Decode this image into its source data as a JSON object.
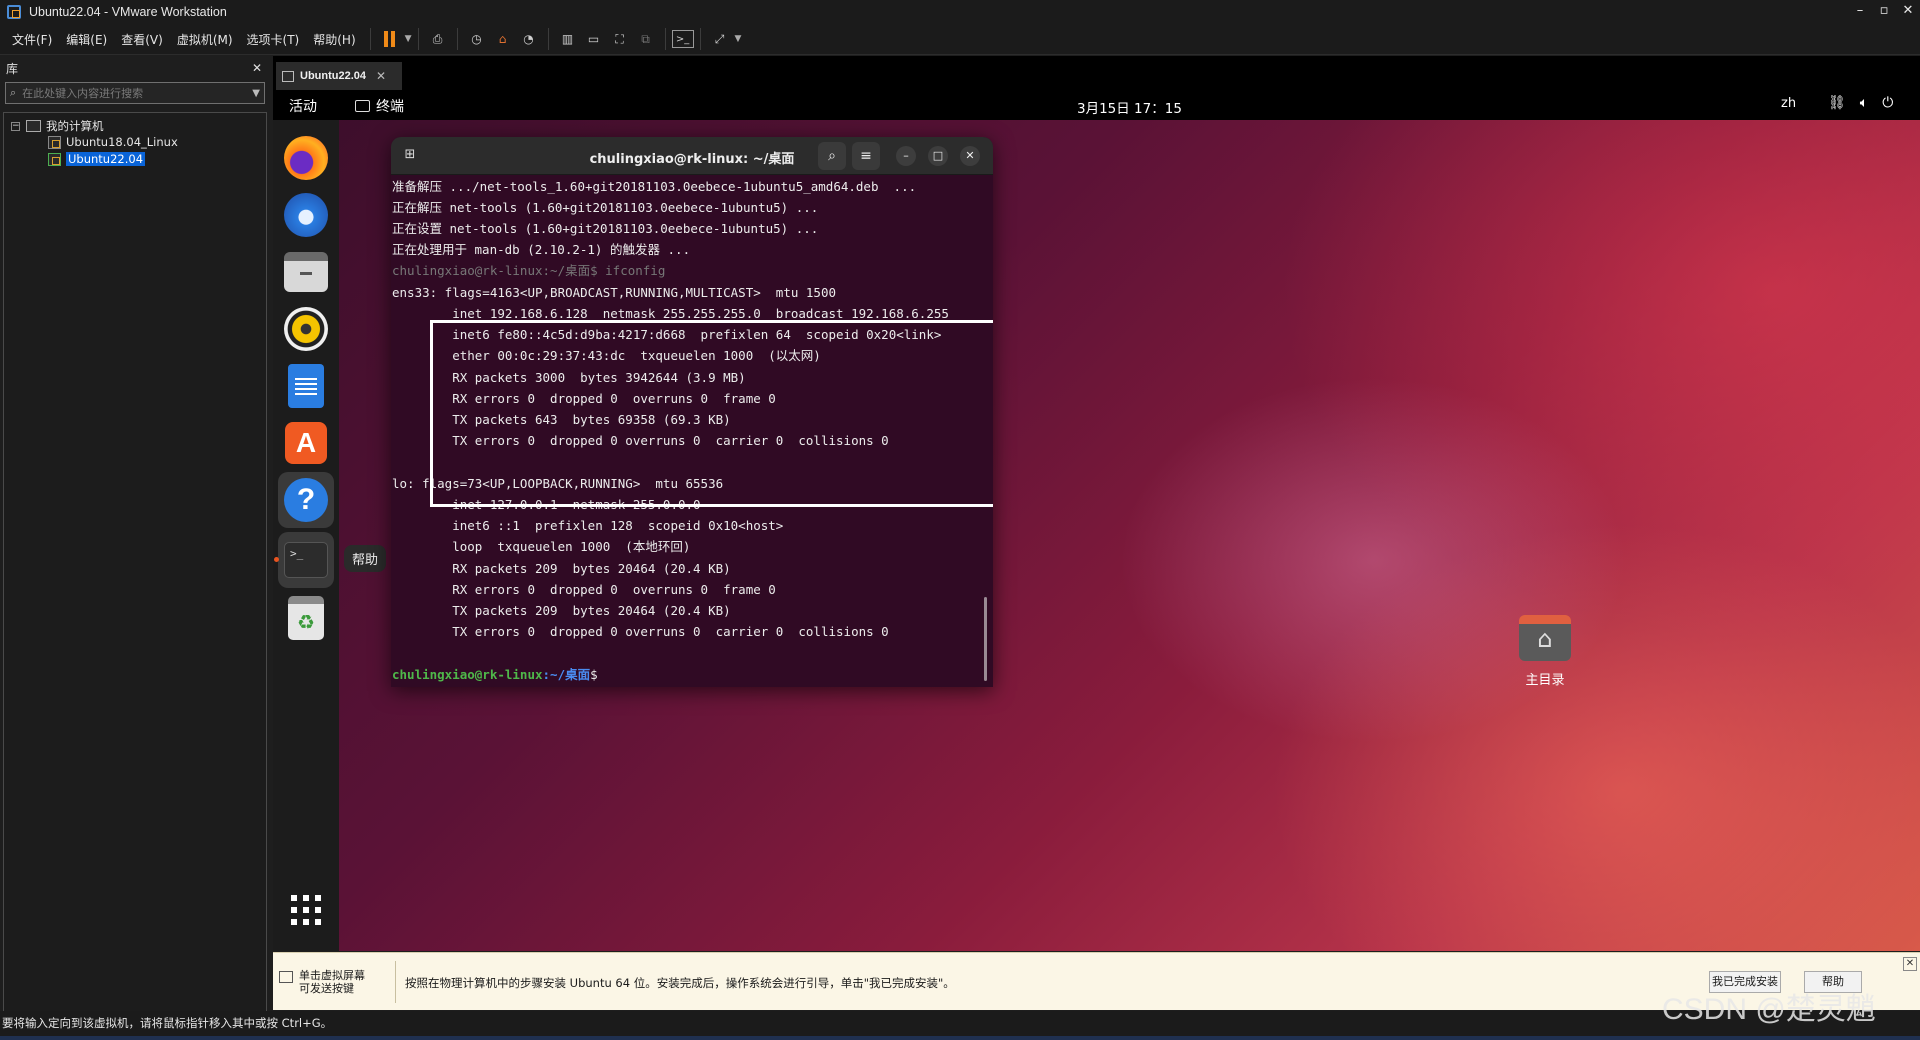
{
  "vmware": {
    "title": "Ubuntu22.04 - VMware Workstation",
    "menu": [
      "文件(F)",
      "编辑(E)",
      "查看(V)",
      "虚拟机(M)",
      "选项卡(T)",
      "帮助(H)"
    ],
    "library": {
      "label": "库",
      "search_placeholder": "在此处键入内容进行搜索",
      "root": "我的计算机",
      "vms": [
        "Ubuntu18.04_Linux",
        "Ubuntu22.04"
      ]
    },
    "tab": "Ubuntu22.04"
  },
  "ubuntu": {
    "activities": "活动",
    "app_name": "终端",
    "clock": "3月15日  17：15",
    "lang": "zh",
    "help_tooltip": "帮助",
    "home_folder": "主目录"
  },
  "terminal": {
    "title": "chulingxiao@rk-linux: ~/桌面",
    "lines": [
      "准备解压 .../net-tools_1.60+git20181103.0eebece-1ubuntu5_amd64.deb  ...",
      "正在解压 net-tools (1.60+git20181103.0eebece-1ubuntu5) ...",
      "正在设置 net-tools (1.60+git20181103.0eebece-1ubuntu5) ...",
      "正在处理用于 man-db (2.10.2-1) 的触发器 ...",
      "chulingxiao@rk-linux:~/桌面$ ifconfig",
      "ens33: flags=4163<UP,BROADCAST,RUNNING,MULTICAST>  mtu 1500",
      "        inet 192.168.6.128  netmask 255.255.255.0  broadcast 192.168.6.255",
      "        inet6 fe80::4c5d:d9ba:4217:d668  prefixlen 64  scopeid 0x20<link>",
      "        ether 00:0c:29:37:43:dc  txqueuelen 1000  (以太网)",
      "        RX packets 3000  bytes 3942644 (3.9 MB)",
      "        RX errors 0  dropped 0  overruns 0  frame 0",
      "        TX packets 643  bytes 69358 (69.3 KB)",
      "        TX errors 0  dropped 0 overruns 0  carrier 0  collisions 0",
      "",
      "lo: flags=73<UP,LOOPBACK,RUNNING>  mtu 65536",
      "        inet 127.0.0.1  netmask 255.0.0.0",
      "        inet6 ::1  prefixlen 128  scopeid 0x10<host>",
      "        loop  txqueuelen 1000  (本地环回)",
      "        RX packets 209  bytes 20464 (20.4 KB)",
      "        RX errors 0  dropped 0  overruns 0  frame 0",
      "        TX packets 209  bytes 20464 (20.4 KB)",
      "        TX errors 0  dropped 0 overruns 0  carrier 0  collisions 0",
      ""
    ],
    "prompt_user": "chulingxiao@rk-linux",
    "prompt_path": ":~/桌面",
    "prompt_symbol": "$"
  },
  "hint": {
    "left": "单击虚拟屏幕\n可发送按键",
    "message": "按照在物理计算机中的步骤安装 Ubuntu 64 位。安装完成后，操作系统会进行引导，单击\"我已完成安装\"。",
    "done_button": "我已完成安装",
    "help_button": "帮助"
  },
  "status": {
    "message": "要将输入定向到该虚拟机，请将鼠标指针移入其中或按 Ctrl+G。"
  },
  "watermark": "CSDN @楚灵魈",
  "colors": {
    "terminal_bg": "#300a24",
    "prompt_user": "#4fb84a",
    "prompt_path": "#4a8cf0",
    "ubuntu_orange": "#e95420",
    "selection_blue": "#0a64d8"
  }
}
